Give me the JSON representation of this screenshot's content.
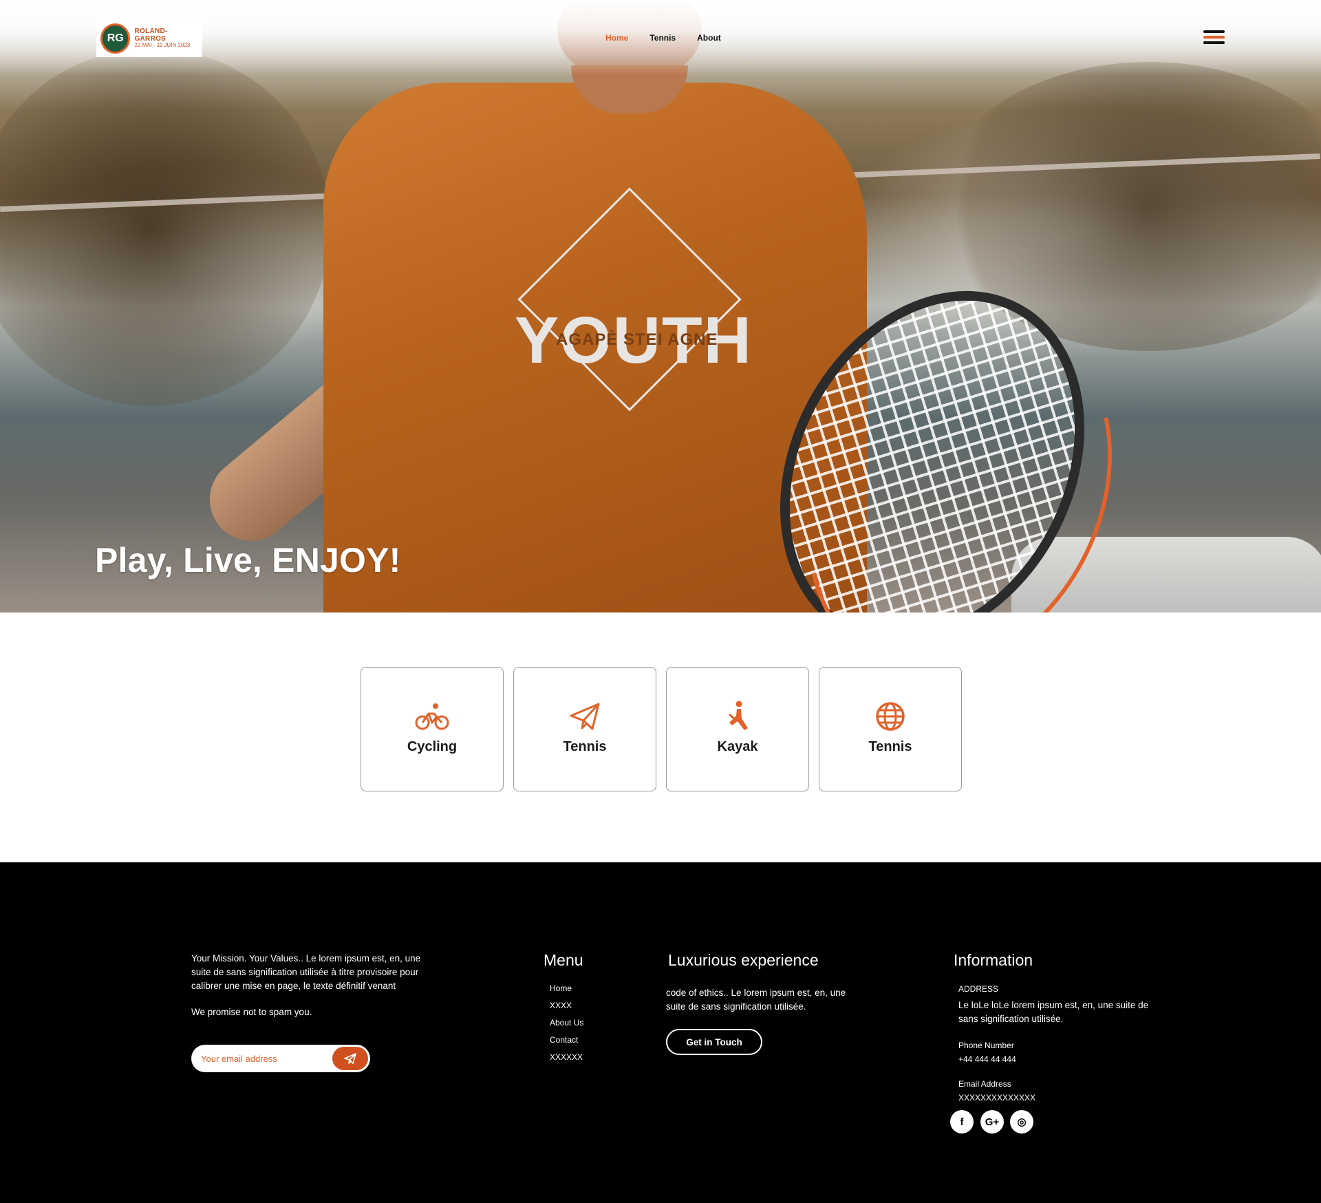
{
  "header": {
    "logo": {
      "title": "ROLAND-GARROS",
      "dates": "22 MAI - 11 JUIN 2023",
      "mark": "RG"
    },
    "nav": [
      {
        "label": "Home",
        "active": true
      },
      {
        "label": "Tennis",
        "active": false
      },
      {
        "label": "About",
        "active": false
      }
    ],
    "menu_icon": "hamburger-icon"
  },
  "hero": {
    "heading": "Play, Live, ENJOY!",
    "shirt_text": "YOUTH",
    "shirt_sub": "AGAPÈ STEI AGNE"
  },
  "cards": [
    {
      "label": "Cycling",
      "icon": "bicycle-icon"
    },
    {
      "label": "Tennis",
      "icon": "paper-plane-icon"
    },
    {
      "label": "Kayak",
      "icon": "person-icon"
    },
    {
      "label": "Tennis",
      "icon": "globe-icon"
    }
  ],
  "footer": {
    "mission": "Your Mission. Your Values.. Le lorem ipsum est, en, une suite de  sans signification utilisée à titre provisoire pour calibrer une mise en  page, le texte définitif venant",
    "spam_note": "We promise not to spam you.",
    "email_placeholder": "Your email address",
    "menu_heading": "Menu",
    "menu_items": [
      "Home",
      "XXXX",
      "About Us",
      "Contact",
      "XXXXXX"
    ],
    "lux_heading": "Luxurious experience",
    "lux_text": "code of ethics.. Le lorem ipsum est, en, une suite de  sans signification utilisée.",
    "touch_label": "Get in Touch",
    "info_heading": "Information",
    "address_label": "ADDRESS",
    "address_text": "Le loLe loLe lorem ipsum est, en, une suite de  sans signification utilisée.",
    "phone_label": "Phone Number",
    "phone_value": "+44 444 44 444",
    "email_label": "Email Address",
    "email_value": "XXXXXXXXXXXXXX",
    "social": [
      {
        "icon": "facebook-icon",
        "glyph": "f"
      },
      {
        "icon": "google-plus-icon",
        "glyph": "G+"
      },
      {
        "icon": "instagram-icon",
        "glyph": "◎"
      }
    ]
  },
  "colors": {
    "accent": "#e2622a",
    "footer_bg": "#000000",
    "text": "#111111"
  }
}
